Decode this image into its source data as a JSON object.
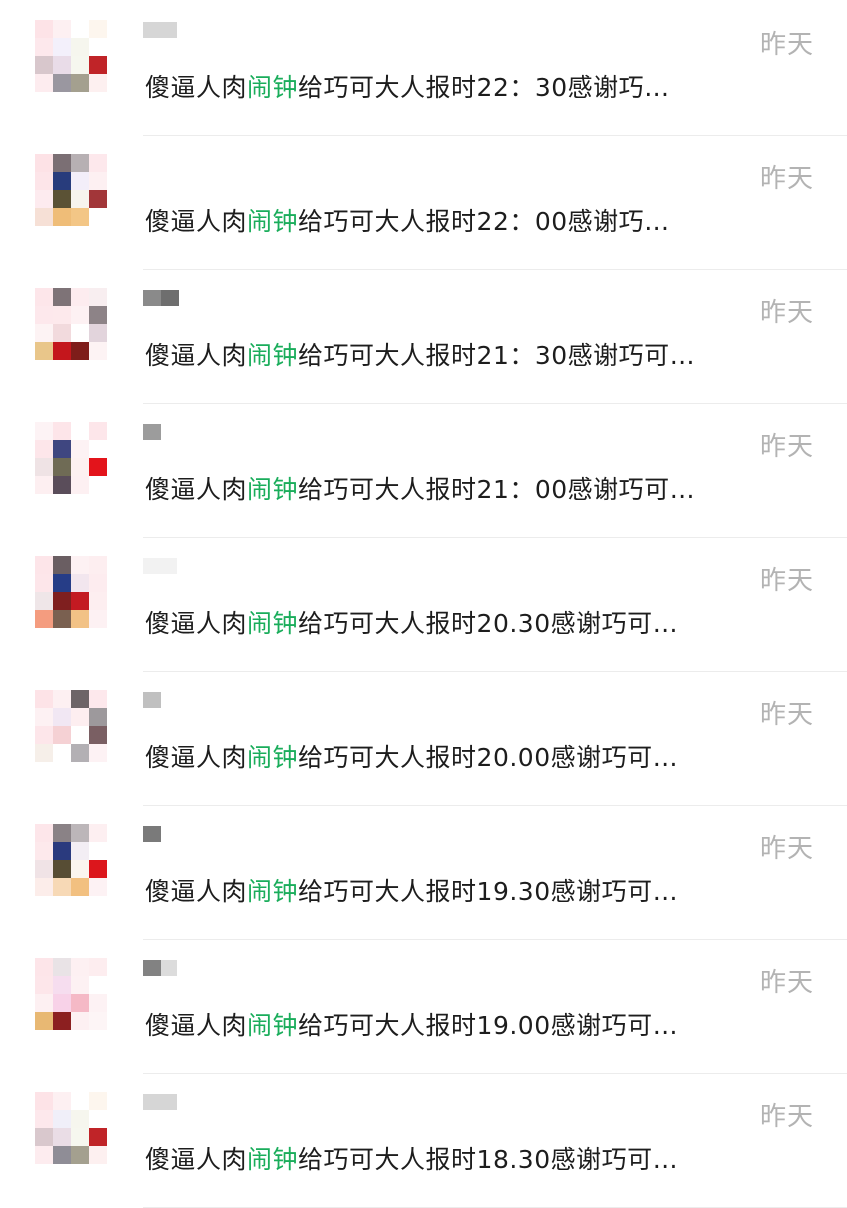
{
  "colors": {
    "highlight": "#1aad5b",
    "time": "#b3b3b3",
    "text": "#1d1d1d"
  },
  "message_prefix": "傻逼人肉",
  "message_highlight": "闹钟",
  "chats": [
    {
      "time": "昨天",
      "message_rest": "给巧可大人报时22：30感谢巧…",
      "avatar": [
        "#fde3e7",
        "#fdf0f2",
        "#ffffff",
        "#fdf6ee",
        "#fde8ec",
        "#f3f0fb",
        "#f6f6ee",
        "#ffffff",
        "#d8c7cc",
        "#e9dce8",
        "#f6f7ef",
        "#c02428",
        "#fdecef",
        "#9a97a0",
        "#a4a08f",
        "#fdf0f0"
      ],
      "name_blocks": [
        [
          "#d6d6d6",
          34,
          16
        ]
      ]
    },
    {
      "time": "昨天",
      "message_rest": "给巧可大人报时22：00感谢巧…",
      "avatar": [
        "#fde2e6",
        "#7b6f74",
        "#b7b0b3",
        "#fde8ec",
        "#fde5e9",
        "#283c7c",
        "#f3eef9",
        "#fdf0f2",
        "#fdebef",
        "#5b5235",
        "#f7f4ee",
        "#a23639",
        "#f6e0d6",
        "#efbd78",
        "#f3c686",
        "#ffffff"
      ],
      "name_blocks": []
    },
    {
      "time": "昨天",
      "message_rest": "给巧可大人报时21：30感谢巧可…",
      "avatar": [
        "#fde6ea",
        "#7e7377",
        "#fdecef",
        "#f8eef0",
        "#fde8ec",
        "#fde9ec",
        "#fdf1f3",
        "#8d8387",
        "#fdf3f4",
        "#f2dadd",
        "#ffffff",
        "#e2d4dc",
        "#e9c68a",
        "#c4161c",
        "#7e1d1a",
        "#fdf3f4"
      ],
      "name_blocks": [
        [
          "#8a8a8a",
          18,
          16
        ],
        [
          "#6e6e6e",
          18,
          16
        ]
      ]
    },
    {
      "time": "昨天",
      "message_rest": "给巧可大人报时21：00感谢巧可…",
      "avatar": [
        "#fdf3f5",
        "#fde5e9",
        "#ffffff",
        "#fde6ea",
        "#fde6ea",
        "#3f4680",
        "#fdf2f4",
        "#ffffff",
        "#efe3e5",
        "#6f6b55",
        "#fdf1f1",
        "#e3141b",
        "#fdeff1",
        "#5a4d5a",
        "#fdf0f2",
        "#ffffff"
      ],
      "name_blocks": [
        [
          "#9c9c9c",
          18,
          16
        ]
      ]
    },
    {
      "time": "昨天",
      "message_rest": "给巧可大人报时20.30感谢巧可…",
      "avatar": [
        "#fde5e9",
        "#6a5e62",
        "#fdf1f3",
        "#fdeef0",
        "#fde6ea",
        "#263d87",
        "#f2e6ee",
        "#fdecef",
        "#efe6e8",
        "#7f1f1f",
        "#c31a22",
        "#fdeef0",
        "#f49c7f",
        "#7a6050",
        "#f2c286",
        "#fdf1f3"
      ],
      "name_blocks": [
        [
          "#f2f2f2",
          34,
          16
        ]
      ]
    },
    {
      "time": "昨天",
      "message_rest": "给巧可大人报时20.00感谢巧可…",
      "avatar": [
        "#fde3e7",
        "#fdf0f2",
        "#6d6467",
        "#fde8ec",
        "#fdf1f3",
        "#f1e7f3",
        "#fdeef0",
        "#9d999c",
        "#fde6ea",
        "#f5d1d4",
        "#ffffff",
        "#7a5f63",
        "#f6efe9",
        "#ffffff",
        "#b3b0b4",
        "#fdf2f4"
      ],
      "name_blocks": [
        [
          "#c0c0c0",
          18,
          16
        ]
      ]
    },
    {
      "time": "昨天",
      "message_rest": "给巧可大人报时19.30感谢巧可…",
      "avatar": [
        "#fde6ea",
        "#8a8286",
        "#bcb6b9",
        "#fdeff1",
        "#fde9ec",
        "#2a3a7e",
        "#f3eef4",
        "#ffffff",
        "#f0e3e6",
        "#574d34",
        "#fbf5ee",
        "#dc161c",
        "#fcedea",
        "#f7d9b6",
        "#f2c080",
        "#fdf2f4"
      ],
      "name_blocks": [
        [
          "#7a7a7a",
          18,
          16
        ]
      ]
    },
    {
      "time": "昨天",
      "message_rest": "给巧可大人报时19.00感谢巧可…",
      "avatar": [
        "#fde5e9",
        "#e9e3e6",
        "#fdf0f2",
        "#fdedef",
        "#fde6ea",
        "#f6ddef",
        "#fdf1f3",
        "#ffffff",
        "#fdf0f2",
        "#f8d2e8",
        "#f5b9c6",
        "#fdf2f4",
        "#e8b873",
        "#8c1f20",
        "#fdf0f2",
        "#fdf5f6"
      ],
      "name_blocks": [
        [
          "#828282",
          18,
          16
        ],
        [
          "#dcdcdc",
          16,
          16
        ]
      ]
    },
    {
      "time": "昨天",
      "message_rest": "给巧可大人报时18.30感谢巧可…",
      "avatar": [
        "#fde3e7",
        "#fdf0f2",
        "#ffffff",
        "#fdf6ee",
        "#fde8ec",
        "#f0eff9",
        "#f6f6ee",
        "#ffffff",
        "#d9c8cd",
        "#eadde6",
        "#f6f7ef",
        "#c02428",
        "#fdecef",
        "#8f8d96",
        "#a4a08f",
        "#fdf0f0"
      ],
      "name_blocks": [
        [
          "#d6d6d6",
          34,
          16
        ]
      ]
    }
  ]
}
